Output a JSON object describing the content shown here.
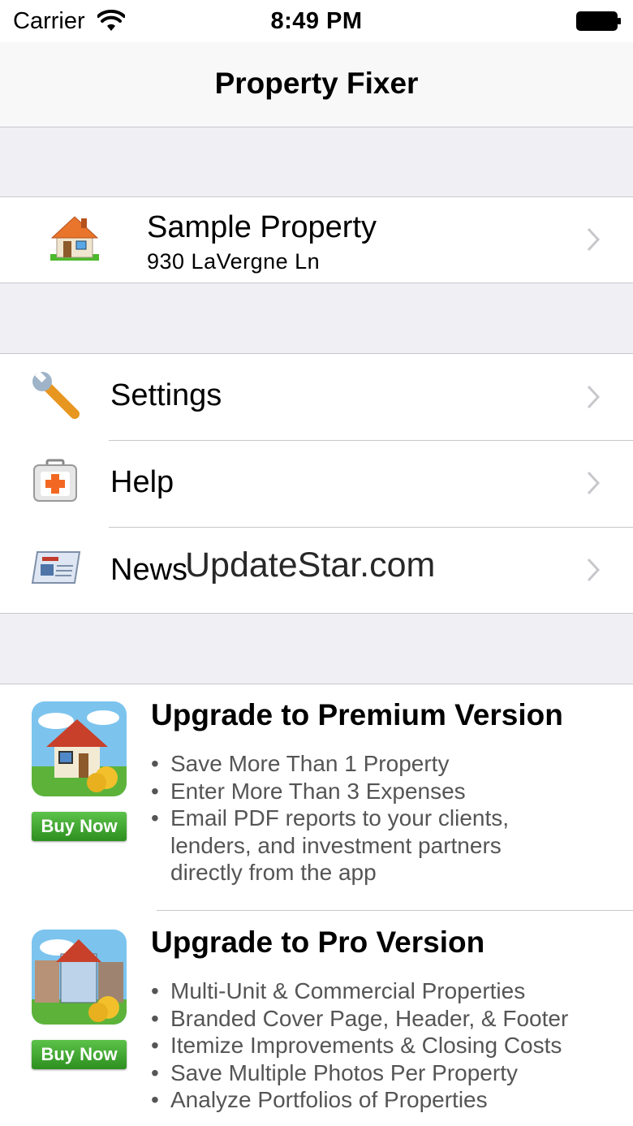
{
  "status_bar": {
    "carrier": "Carrier",
    "time": "8:49 PM"
  },
  "nav": {
    "title": "Property Fixer"
  },
  "property": {
    "name": "Sample Property",
    "address": "930 LaVergne Ln"
  },
  "menu": [
    {
      "label": "Settings",
      "icon": "wrench-icon"
    },
    {
      "label": "Help",
      "icon": "first-aid-kit-icon"
    },
    {
      "label": "News",
      "icon": "newspaper-icon"
    }
  ],
  "watermark": "UpdateStar.com",
  "promos": [
    {
      "title": "Upgrade to Premium Version",
      "buy_label": "Buy Now",
      "bullets": [
        "Save More Than 1 Property",
        "Enter More Than 3 Expenses",
        "Email PDF reports to your clients, lenders, and investment partners directly from the app"
      ]
    },
    {
      "title": "Upgrade to Pro Version",
      "buy_label": "Buy Now",
      "bullets": [
        "Multi-Unit & Commercial Properties",
        "Branded Cover Page, Header, & Footer",
        "Itemize Improvements & Closing Costs",
        "Save Multiple Photos Per Property",
        "Analyze Portfolios of Properties"
      ]
    }
  ],
  "colors": {
    "group_background": "#efeff4",
    "separator": "#c8c7cc",
    "chevron": "#c7c7cc",
    "buy_button": "#3ea12e"
  }
}
